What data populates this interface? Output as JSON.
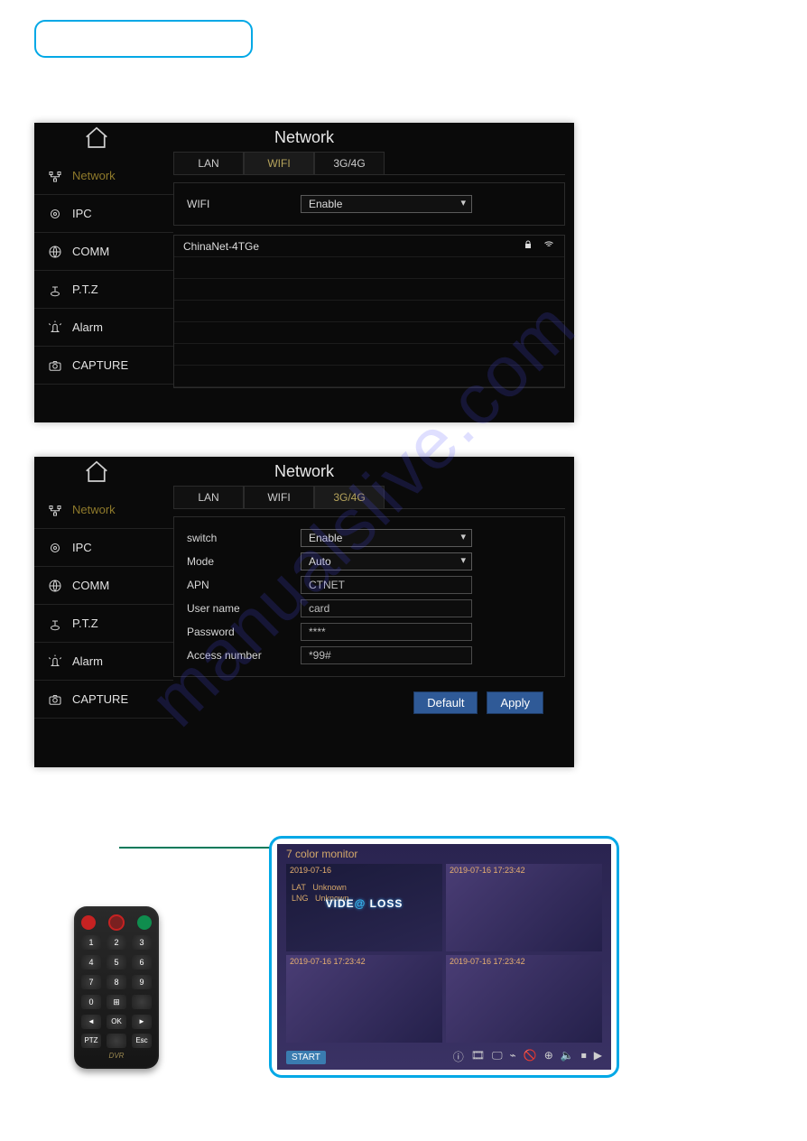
{
  "watermark": "manualslive.com",
  "shot1": {
    "title": "Network",
    "sidebar": [
      "Network",
      "IPC",
      "COMM",
      "P.T.Z",
      "Alarm",
      "CAPTURE"
    ],
    "tabs": [
      "LAN",
      "WIFI",
      "3G/4G"
    ],
    "active_tab": "WIFI",
    "wifi_label": "WIFI",
    "wifi_value": "Enable",
    "networks": [
      {
        "ssid": "ChinaNet-4TGe",
        "locked": true
      }
    ]
  },
  "shot2": {
    "title": "Network",
    "sidebar": [
      "Network",
      "IPC",
      "COMM",
      "P.T.Z",
      "Alarm",
      "CAPTURE"
    ],
    "tabs": [
      "LAN",
      "WIFI",
      "3G/4G"
    ],
    "active_tab": "3G/4G",
    "rows": [
      {
        "label": "switch",
        "type": "select",
        "value": "Enable"
      },
      {
        "label": "Mode",
        "type": "select",
        "value": "Auto"
      },
      {
        "label": "APN",
        "type": "input",
        "value": "CTNET"
      },
      {
        "label": "User name",
        "type": "input",
        "value": "card"
      },
      {
        "label": "Password",
        "type": "input",
        "value": "****"
      },
      {
        "label": "Access number",
        "type": "input",
        "value": "*99#"
      }
    ],
    "buttons": {
      "default": "Default",
      "apply": "Apply"
    }
  },
  "monitor": {
    "title": "7 color monitor",
    "q": [
      {
        "time": "2019-07-16",
        "lat": "LAT",
        "lat_v": "Unknown",
        "lng": "LNG",
        "lng_v": "Unknown",
        "video_loss": "VIDE  LOSS"
      },
      {
        "time": "2019-07-16 17:23:42"
      },
      {
        "time": "2019-07-16 17:23:42"
      },
      {
        "time": "2019-07-16 17:23:42"
      }
    ],
    "start": "START"
  },
  "remote": {
    "numbers": [
      "1",
      "2",
      "3",
      "4",
      "5",
      "6",
      "7",
      "8",
      "9",
      "0",
      "⊞",
      " "
    ],
    "controls": [
      "◄",
      "OK",
      "►",
      "PTZ",
      " ",
      "Esc"
    ],
    "brand": "DVR"
  }
}
